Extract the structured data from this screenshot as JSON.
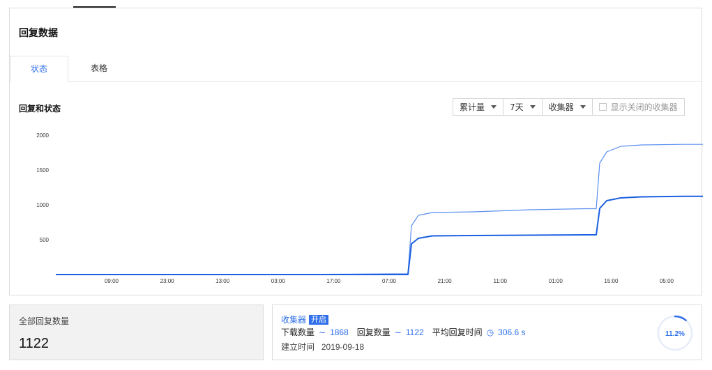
{
  "page": {
    "title": "回复数据"
  },
  "tabs": [
    {
      "label": "状态",
      "active": true
    },
    {
      "label": "表格",
      "active": false
    }
  ],
  "chart_section": {
    "title": "回复和状态",
    "controls": {
      "mode": "累计量",
      "range": "7天",
      "collector": "收集器",
      "show_closed_label": "显示关闭的收集器",
      "show_closed_checked": false
    }
  },
  "chart_data": {
    "type": "line",
    "title": "",
    "xlabel": "",
    "ylabel": "",
    "ylim": [
      0,
      2000
    ],
    "yticks": [
      500,
      1000,
      1500,
      2000
    ],
    "ytick_labels": [
      "500",
      "1000",
      "1500",
      "2000"
    ],
    "xtick_labels": [
      "09:00",
      "23:00",
      "13:00",
      "03:00",
      "17:00",
      "07:00",
      "21:00",
      "11:00",
      "01:00",
      "15:00",
      "05:00"
    ],
    "grid": false,
    "x": [
      0,
      80,
      160,
      240,
      320,
      400,
      480,
      500,
      505,
      510,
      520,
      540,
      600,
      680,
      760,
      770,
      775,
      780,
      790,
      810,
      840,
      900,
      928
    ],
    "series": [
      {
        "color": "#5b8ff0",
        "values": [
          0,
          0,
          0,
          0,
          0,
          5,
          10,
          10,
          10,
          700,
          850,
          890,
          900,
          930,
          945,
          945,
          945,
          1600,
          1760,
          1840,
          1860,
          1868,
          1868
        ]
      },
      {
        "color": "#1a5fe0",
        "values": [
          0,
          0,
          0,
          0,
          0,
          0,
          0,
          0,
          0,
          440,
          520,
          555,
          560,
          565,
          570,
          570,
          570,
          950,
          1060,
          1100,
          1115,
          1122,
          1122
        ]
      }
    ]
  },
  "total": {
    "label": "全部回复数量",
    "value": "1122"
  },
  "collector_card": {
    "name": "收集器",
    "status_badge": "开启",
    "downloads_label": "下载数量",
    "downloads_icon": "trend-icon",
    "downloads": "1868",
    "responses_label": "回复数量",
    "responses_icon": "trend-icon",
    "responses": "1122",
    "avg_time_label": "平均回复时间",
    "avg_time_icon": "clock-icon",
    "avg_time": "306.6 s",
    "created_label": "建立时间",
    "created_date": "2019-09-18",
    "completion_label": "11.2%",
    "completion_fraction": 0.112,
    "accent": "#2f6fea"
  }
}
